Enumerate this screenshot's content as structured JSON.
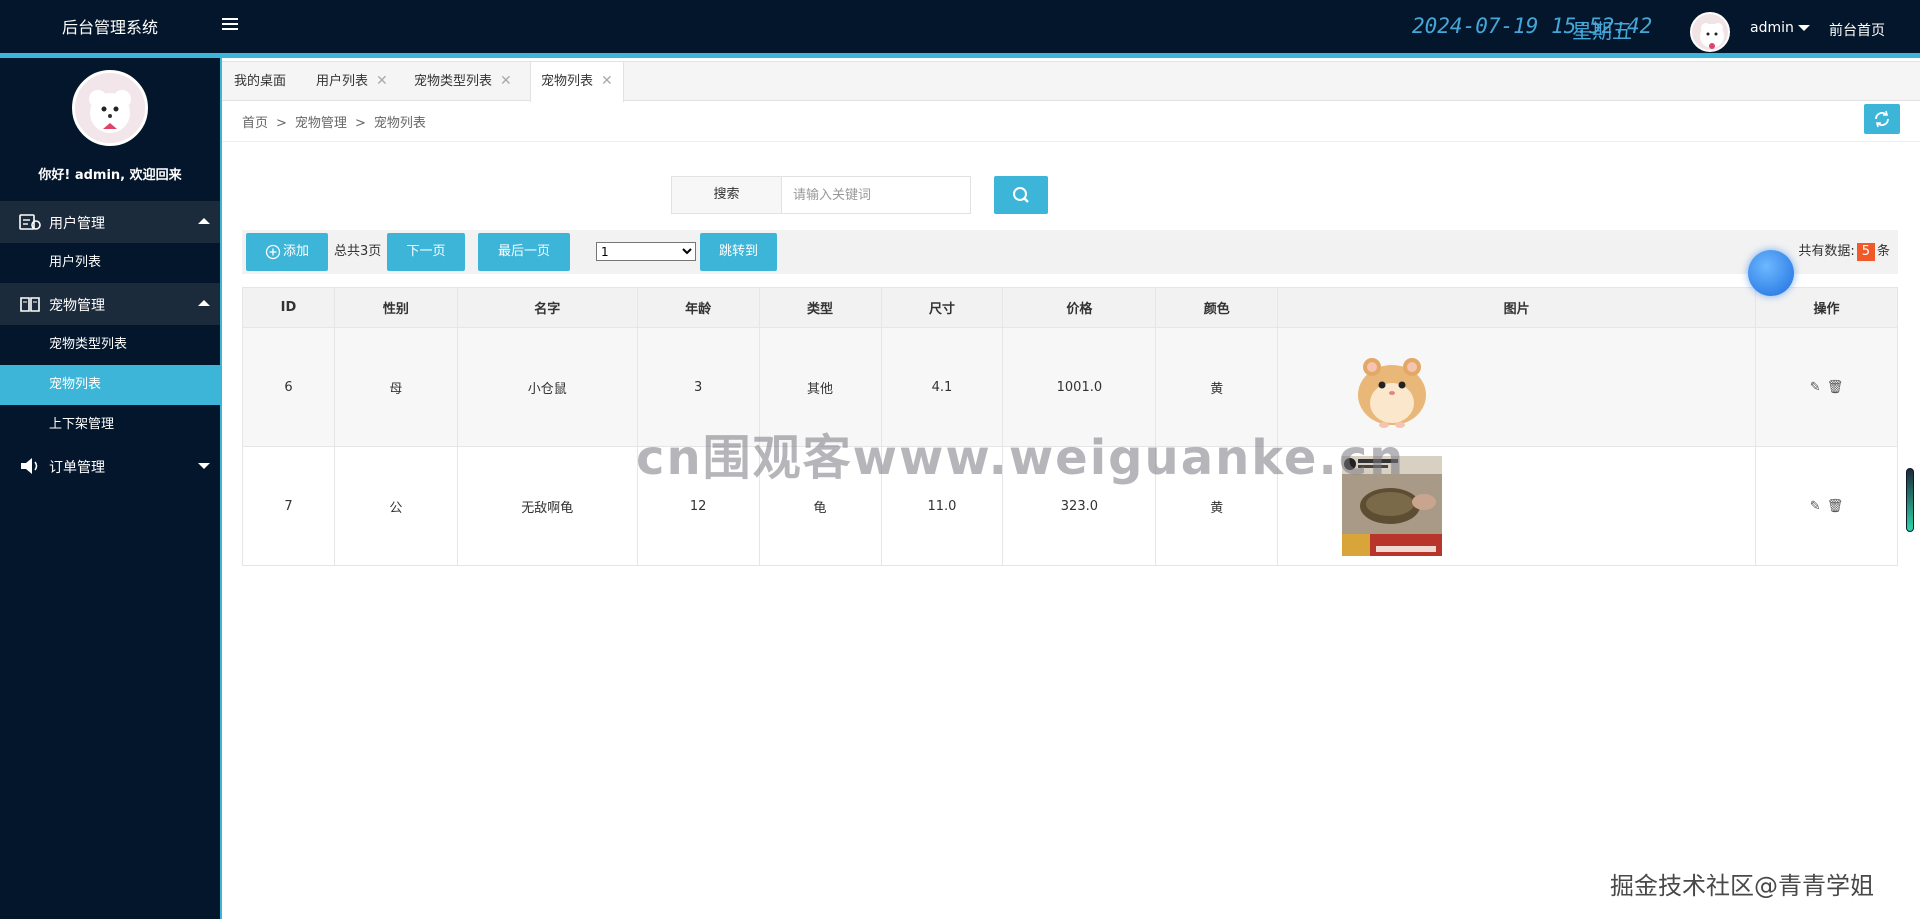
{
  "header": {
    "brand": "后台管理系统",
    "date": "2024-07-19",
    "time": "15:52:42",
    "weekday": "星期五",
    "username": "admin",
    "front_link": "前台首页"
  },
  "sidebar": {
    "welcome": "你好! admin, 欢迎回来",
    "groups": [
      {
        "label": "用户管理",
        "items": [
          {
            "label": "用户列表"
          }
        ]
      },
      {
        "label": "宠物管理",
        "items": [
          {
            "label": "宠物类型列表"
          },
          {
            "label": "宠物列表"
          },
          {
            "label": "上下架管理"
          }
        ]
      },
      {
        "label": "订单管理",
        "items": []
      }
    ]
  },
  "tabs": [
    {
      "label": "我的桌面"
    },
    {
      "label": "用户列表",
      "close": "✕"
    },
    {
      "label": "宠物类型列表",
      "close": "✕"
    },
    {
      "label": "宠物列表",
      "close": "✕"
    }
  ],
  "breadcrumb": {
    "home": "首页",
    "section": "宠物管理",
    "page": "宠物列表",
    "sep": ">"
  },
  "search": {
    "label": "搜索",
    "placeholder": "请输入关键词"
  },
  "toolbar": {
    "add_label": "添加",
    "total_pages": "总共3页",
    "next_label": "下一页",
    "last_label": "最后一页",
    "page_selected": "1",
    "jump_label": "跳转到",
    "count_prefix": "共有数据:",
    "count": "5",
    "count_suffix": "条"
  },
  "table": {
    "headers": [
      "ID",
      "性别",
      "名字",
      "年龄",
      "类型",
      "尺寸",
      "价格",
      "颜色",
      "图片",
      "操作"
    ],
    "rows": [
      {
        "id": "6",
        "gender": "母",
        "name": "小仓鼠",
        "age": "3",
        "type": "其他",
        "size": "4.1",
        "price": "1001.0",
        "color": "黄"
      },
      {
        "id": "7",
        "gender": "公",
        "name": "无敌啊龟",
        "age": "12",
        "type": "龟",
        "size": "11.0",
        "price": "323.0",
        "color": "黄"
      }
    ]
  },
  "watermarks": {
    "center": "cn围观客www.weiguanke.cn",
    "corner": "掘金技术社区@青青学姐"
  },
  "colors": {
    "accent": "#3db5d8",
    "sidebar_bg": "#04162b",
    "badge": "#f05a28"
  }
}
